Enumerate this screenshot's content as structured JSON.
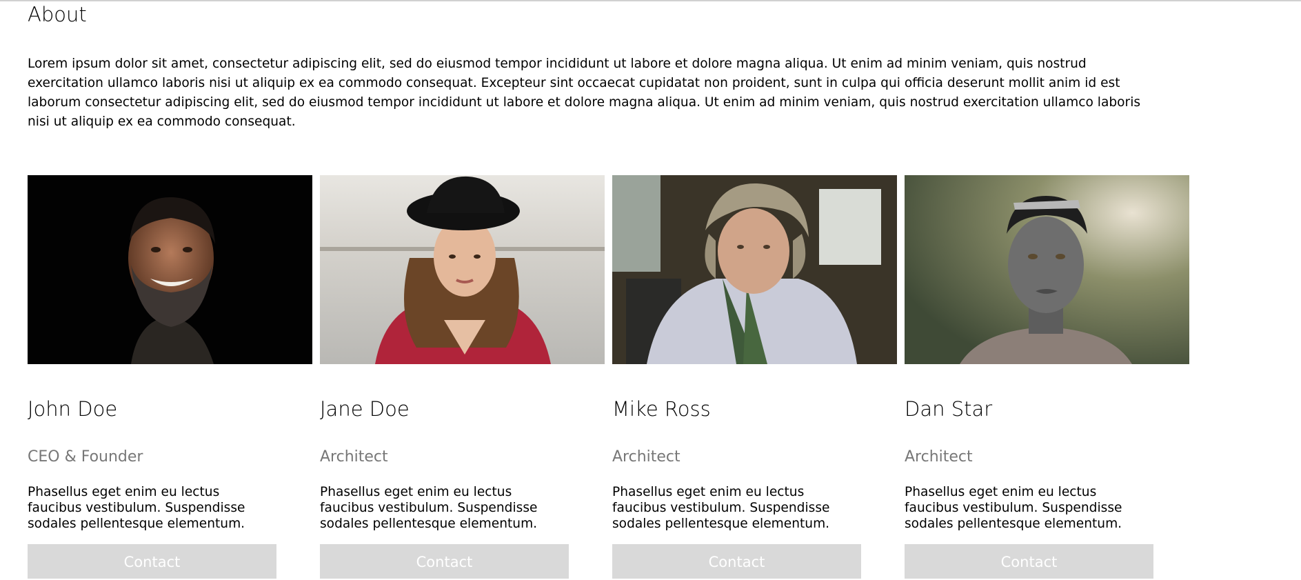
{
  "about": {
    "title": "About",
    "text": "Lorem ipsum dolor sit amet, consectetur adipiscing elit, sed do eiusmod tempor incididunt ut labore et dolore magna aliqua. Ut enim ad minim veniam, quis nostrud exercitation ullamco laboris nisi ut aliquip ex ea commodo consequat. Excepteur sint occaecat cupidatat non proident, sunt in culpa qui officia deserunt mollit anim id est laborum consectetur adipiscing elit, sed do eiusmod tempor incididunt ut labore et dolore magna aliqua. Ut enim ad minim veniam, quis nostrud exercitation ullamco laboris nisi ut aliquip ex ea commodo consequat."
  },
  "team": [
    {
      "name": "John Doe",
      "role": "CEO & Founder",
      "description": "Phasellus eget enim eu lectus faucibus vestibulum. Suspendisse sodales pellentesque elementum.",
      "contact_label": "Contact"
    },
    {
      "name": "Jane Doe",
      "role": "Architect",
      "description": "Phasellus eget enim eu lectus faucibus vestibulum. Suspendisse sodales pellentesque elementum.",
      "contact_label": "Contact"
    },
    {
      "name": "Mike Ross",
      "role": "Architect",
      "description": "Phasellus eget enim eu lectus faucibus vestibulum. Suspendisse sodales pellentesque elementum.",
      "contact_label": "Contact"
    },
    {
      "name": "Dan Star",
      "role": "Architect",
      "description": "Phasellus eget enim eu lectus faucibus vestibulum. Suspendisse sodales pellentesque elementum.",
      "contact_label": "Contact"
    }
  ],
  "colors": {
    "role_text": "#777777",
    "button_bg": "#d9d9d9",
    "button_text": "#ffffff"
  }
}
